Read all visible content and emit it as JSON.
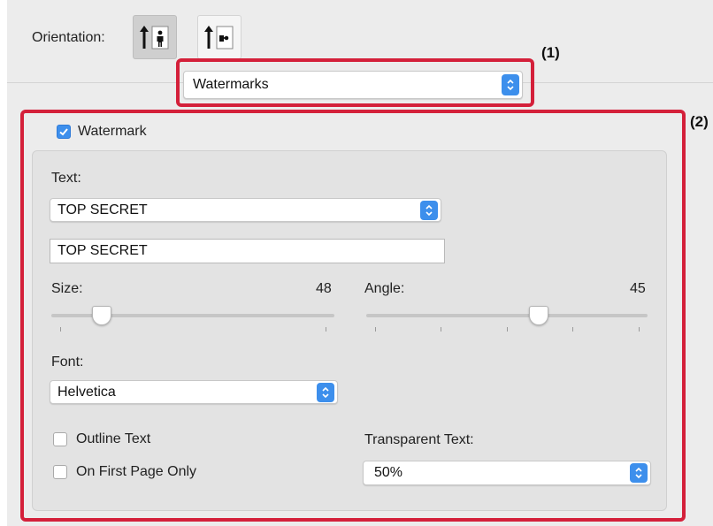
{
  "orientation": {
    "label": "Orientation:",
    "options": [
      {
        "name": "portrait",
        "icon": "portrait-orientation-icon",
        "selected": true
      },
      {
        "name": "landscape",
        "icon": "landscape-orientation-icon",
        "selected": false
      }
    ]
  },
  "panel_select": {
    "value": "Watermarks"
  },
  "callouts": {
    "one": "(1)",
    "two": "(2)"
  },
  "watermark": {
    "checkbox_label": "Watermark",
    "checked": true,
    "text_label": "Text:",
    "text_preset": "TOP SECRET",
    "text_value": "TOP SECRET",
    "size_label": "Size:",
    "size_value": "48",
    "angle_label": "Angle:",
    "angle_value": "45",
    "font_label": "Font:",
    "font_value": "Helvetica",
    "outline_label": "Outline Text",
    "outline_checked": false,
    "first_page_label": "On First Page Only",
    "first_page_checked": false,
    "transparent_label": "Transparent Text:",
    "transparent_value": "50%"
  },
  "colors": {
    "accent": "#3d8fec",
    "highlight": "#d4203a"
  }
}
